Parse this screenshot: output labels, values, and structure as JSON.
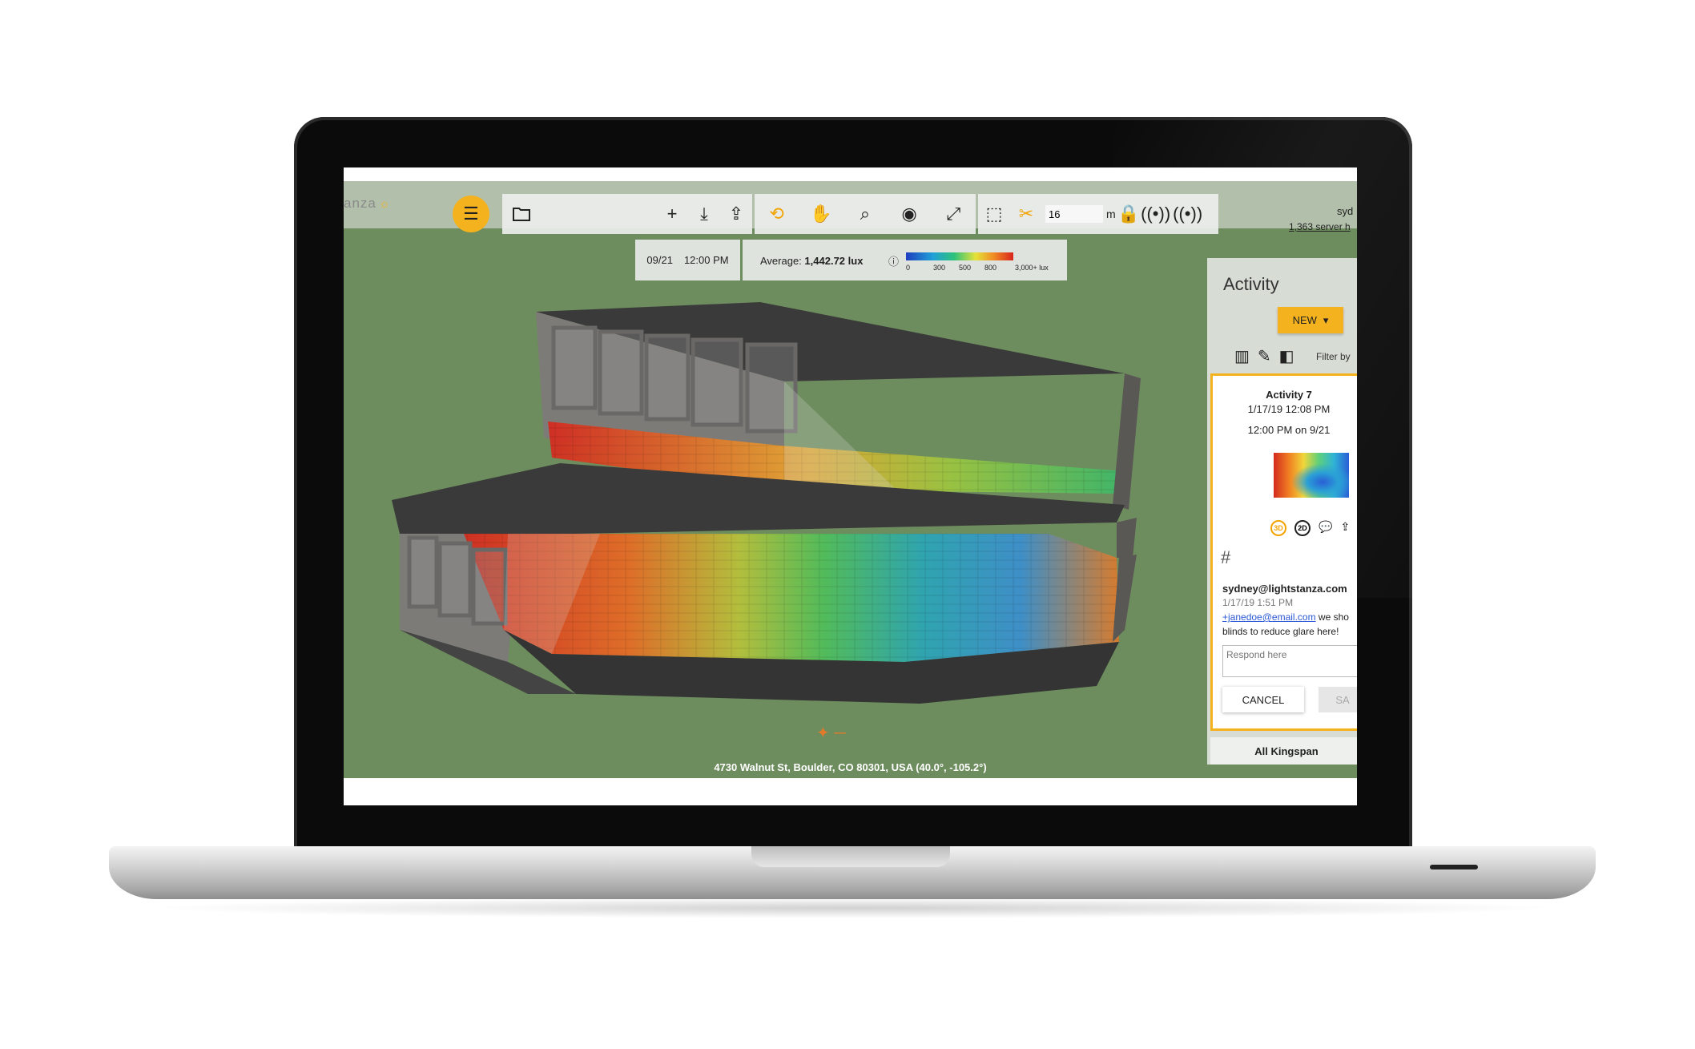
{
  "app": {
    "logo_text": "anza",
    "logo_sun": "☼"
  },
  "toolbar": {
    "distance_value": "16",
    "distance_unit": "m",
    "icons": [
      "menu-star-icon",
      "folder-icon",
      "plus-icon",
      "download-icon",
      "share-icon",
      "orbit-icon",
      "hand-icon",
      "search-icon",
      "eye-icon",
      "expand-icon",
      "cube-icon",
      "scissors-icon",
      "lock-icon",
      "sensor-icon",
      "sensor-alt-icon"
    ]
  },
  "user": {
    "name": "syd",
    "server": "1,363 server h"
  },
  "time_panel": {
    "date": "09/21",
    "time": "12:00 PM"
  },
  "lux_panel": {
    "average_label": "Average:",
    "average_value": "1,442.72 lux",
    "ticks": [
      "0",
      "300",
      "500",
      "800",
      "3,000+ lux"
    ]
  },
  "scene": {
    "address": "4730 Walnut St, Boulder, CO 80301, USA (40.0°, -105.2°)"
  },
  "activity": {
    "title": "Activity",
    "new_button": "NEW",
    "filter_label": "Filter by",
    "card": {
      "title": "Activity 7",
      "date": "1/17/19 12:08 PM",
      "time_note": "12:00 PM on 9/21",
      "comment_author": "sydney@lightstanza.com",
      "comment_date": "1/17/19 1:51 PM",
      "comment_mention": "+janedoe@email.com",
      "comment_text_1": " we sho",
      "comment_text_2": "blinds to reduce glare here!",
      "respond_placeholder": "Respond here",
      "cancel_label": "CANCEL",
      "save_label": "SA",
      "badge_3d": "3D",
      "badge_2d": "2D"
    },
    "footer": "All Kingspan"
  },
  "colors": {
    "accent": "#f4b21f",
    "viewport_bg": "#6e8d5e"
  }
}
